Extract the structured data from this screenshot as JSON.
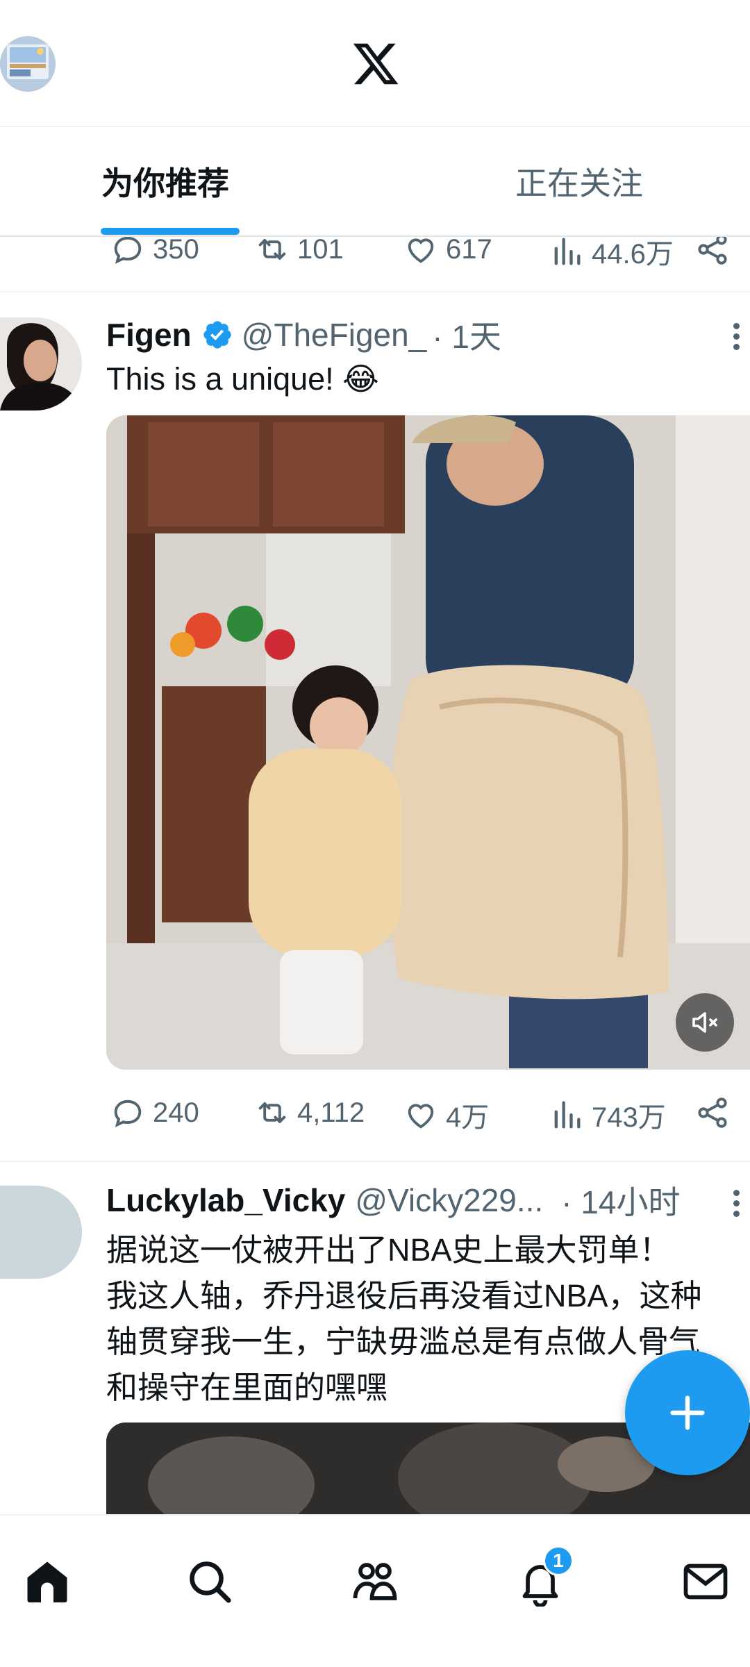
{
  "tabs": {
    "for_you": "为你推荐",
    "following": "正在关注"
  },
  "prev_tweet": {
    "replies": "350",
    "retweets": "101",
    "likes": "617",
    "views": "44.6万"
  },
  "tweet1": {
    "name": "Figen",
    "handle": "@TheFigen_",
    "time": "· 1天",
    "text": "This is a unique! 😂",
    "replies": "240",
    "retweets": "4,112",
    "likes": "4万",
    "views": "743万"
  },
  "tweet2": {
    "name": "Luckylab_Vicky",
    "handle": "@Vicky229...",
    "time": "· 14小时",
    "lines": [
      "据说这一仗被开出了NBA史上最大罚单！",
      "我这人轴，乔丹退役后再没看过NBA，这种",
      "轴贯穿我一生，宁缺毋滥总是有点做人骨气",
      "和操守在里面的嘿嘿"
    ]
  },
  "nav": {
    "notifications_badge": "1"
  },
  "colors": {
    "accent": "#1d9bf0",
    "muted": "#536471",
    "text": "#0f1419"
  },
  "icons": [
    "x-logo-icon",
    "reply-icon",
    "retweet-icon",
    "like-icon",
    "views-icon",
    "share-icon",
    "verified-icon",
    "more-icon",
    "mute-icon",
    "compose-icon",
    "home-icon",
    "search-icon",
    "communities-icon",
    "notifications-icon",
    "messages-icon"
  ]
}
